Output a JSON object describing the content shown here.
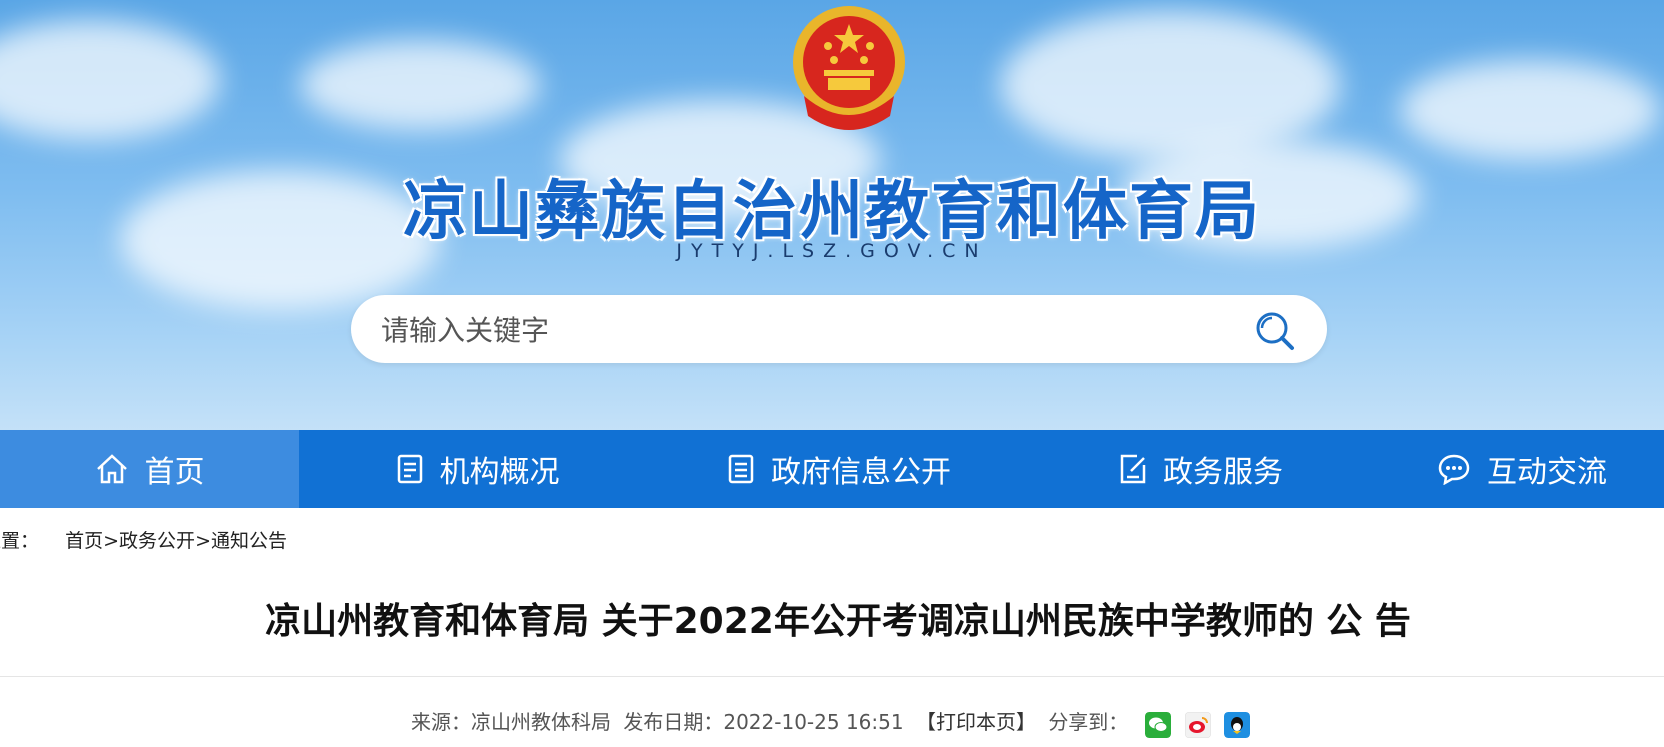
{
  "header": {
    "site_title": "凉山彝族自治州教育和体育局",
    "site_domain": "JYTYJ.LSZ.GOV.CN",
    "emblem_icon": "national-emblem-icon"
  },
  "search": {
    "placeholder": "请输入关键字",
    "icon": "search-icon"
  },
  "nav": {
    "items": [
      {
        "label": "首页",
        "icon": "home-icon",
        "active": true
      },
      {
        "label": "机构概况",
        "icon": "document-list-icon"
      },
      {
        "label": "政府信息公开",
        "icon": "document-icon"
      },
      {
        "label": "政务服务",
        "icon": "edit-document-icon"
      },
      {
        "label": "互动交流",
        "icon": "chat-icon"
      }
    ]
  },
  "breadcrumb": {
    "prefix": "位置：",
    "items": [
      "首页",
      "政务公开",
      "通知公告"
    ],
    "separator": ">"
  },
  "article": {
    "title": "凉山州教育和体育局 关于2022年公开考调凉山州民族中学教师的 公 告",
    "source_label": "来源：",
    "source": "凉山州教体科局",
    "date_label": "发布日期：",
    "date": "2022-10-25 16:51",
    "print_label": "【打印本页】",
    "share_label": "分享到：",
    "share_icons": [
      "wechat-icon",
      "weibo-icon",
      "qq-icon"
    ]
  },
  "colors": {
    "nav_bg": "#1171d4",
    "nav_active": "#3d8ce0",
    "title_blue": "#1565c8"
  }
}
